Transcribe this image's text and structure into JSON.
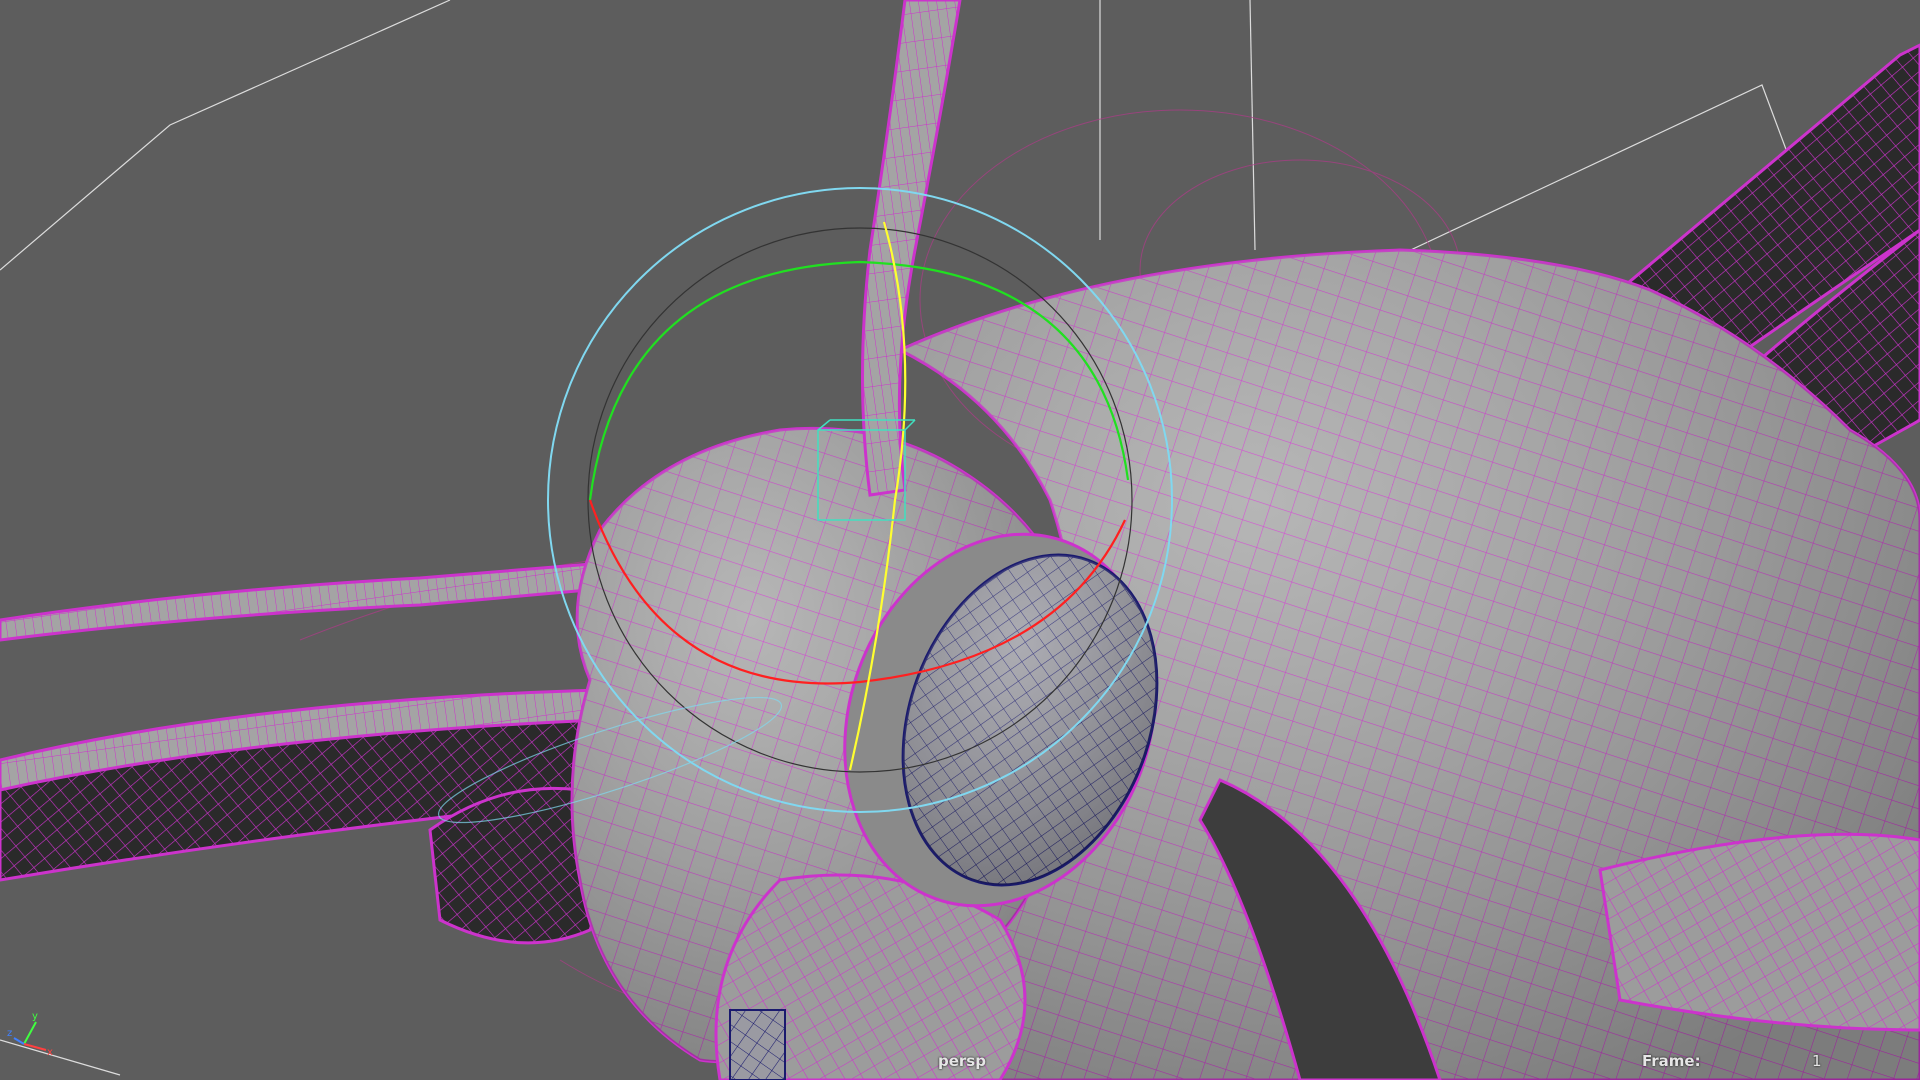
{
  "viewport": {
    "panel": "perspective-viewport",
    "camera_name": "persp",
    "display_mode": "smooth shade with wireframe on shaded",
    "frame_label": "Frame:",
    "frame_value": "1"
  },
  "axis_triad": {
    "x_label": "x",
    "y_label": "y",
    "z_label": "z",
    "colors": {
      "x": "#ff4040",
      "y": "#40ff40",
      "z": "#4080ff"
    }
  },
  "scene": {
    "mesh_fill": "#a9a9a9",
    "wire_color": "#cc33cc",
    "eye_wire_color": "#1a1a6e",
    "rotate_manipulator": {
      "x_ring": "#ff2020",
      "y_ring": "#20e020",
      "z_ring": "#ffff30",
      "view_ring": "#80d8f0"
    },
    "background": "#5d5d5d"
  }
}
